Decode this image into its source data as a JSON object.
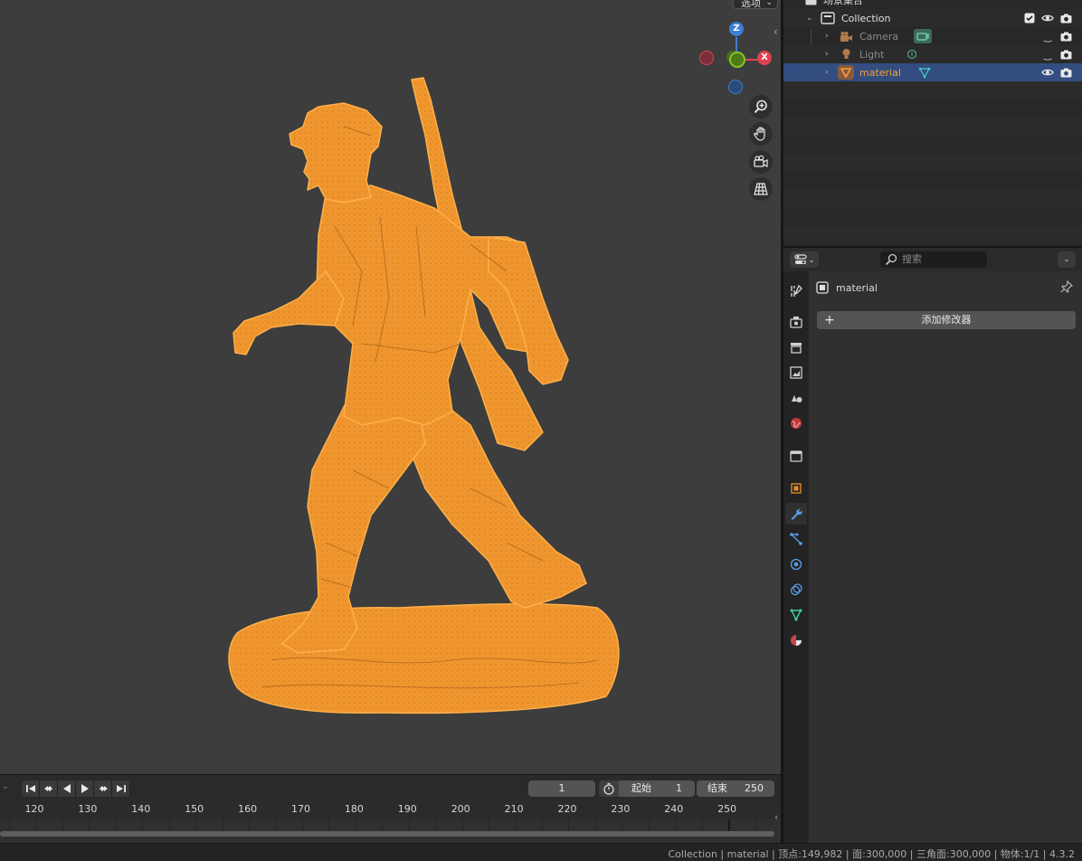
{
  "viewport": {
    "options_label": "选项",
    "gizmo": {
      "z": "Z",
      "x": "X"
    }
  },
  "timeline": {
    "current_frame": "1",
    "start_label": "起始",
    "start_value": "1",
    "end_label": "结束",
    "end_value": "250",
    "ruler_ticks": [
      "120",
      "130",
      "140",
      "150",
      "160",
      "170",
      "180",
      "190",
      "200",
      "210",
      "220",
      "230",
      "240",
      "250"
    ]
  },
  "outliner": {
    "scene_collection": "场景集合",
    "collection": "Collection",
    "items": [
      {
        "label": "Camera"
      },
      {
        "label": "Light"
      },
      {
        "label": "material"
      }
    ]
  },
  "properties": {
    "search_placeholder": "搜索",
    "object_name": "material",
    "add_modifier_label": "添加修改器"
  },
  "statusbar": {
    "text": "Collection | material | 顶点:149,982 | 面:300,000 | 三角面:300,000 | 物体:1/1 | 4.3.2"
  },
  "colors": {
    "selection_orange": "#f0962e",
    "selected_row": "#334d80",
    "axis_x": "#e0404f",
    "axis_y": "#6faa1e",
    "axis_z": "#3d7fd6"
  }
}
